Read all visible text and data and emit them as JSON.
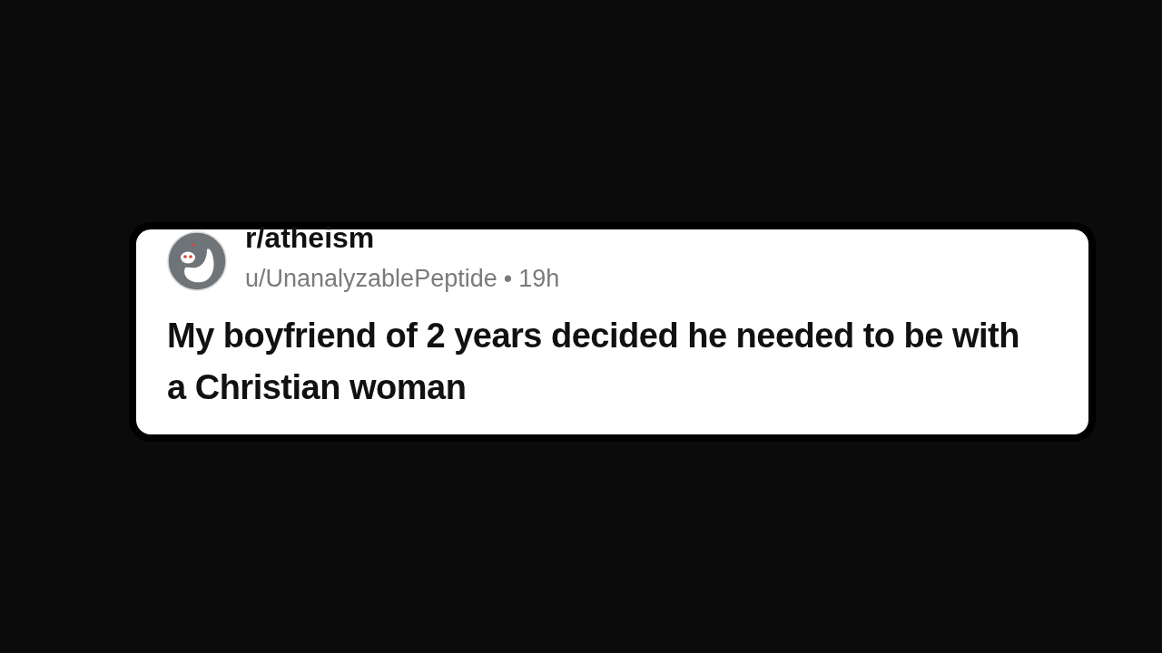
{
  "post": {
    "subreddit": "r/atheism",
    "author": "u/UnanalyzablePeptide",
    "separator": "•",
    "age": "19h",
    "title": "My boyfriend of 2 years decided he needed to be with a Christian woman"
  }
}
